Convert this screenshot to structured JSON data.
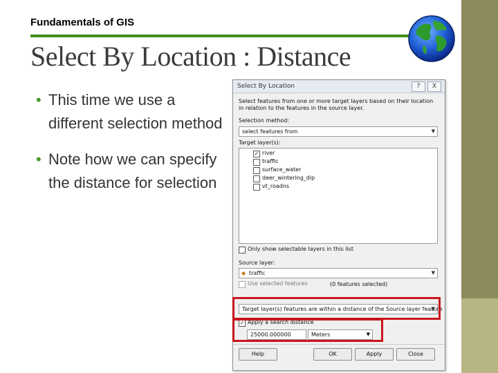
{
  "slide": {
    "course_title": "Fundamentals of GIS",
    "title": "Select By Location : Distance",
    "bullets": [
      "This time we use a different selection method",
      "Note how we can specify the distance for selection"
    ],
    "colors": {
      "accent_green": "#3e8e1a",
      "side_bar": "#8a8a5a",
      "side_bar_accent": "#b7b583",
      "highlight_red": "#c8161d"
    }
  },
  "dialog": {
    "title": "Select By Location",
    "help_button": "?",
    "close_button": "X",
    "description": "Select features from one or more target layers based on their location in relation to the features in the source layer.",
    "selection_method_label": "Selection method:",
    "selection_method_value": "select features from",
    "target_layers_label": "Target layer(s):",
    "target_layers": [
      {
        "label": "river",
        "checked": true
      },
      {
        "label": "traffic",
        "checked": false
      },
      {
        "label": "surface_water",
        "checked": false
      },
      {
        "label": "deer_wintering_dip",
        "checked": false
      },
      {
        "label": "vt_roadns",
        "checked": false
      }
    ],
    "only_selectable_label": "Only show selectable layers in this list",
    "source_layer_label": "Source layer:",
    "source_layer_value": "traffic",
    "use_selected_label": "Use selected features",
    "features_selected": "(0 features selected)",
    "spatial_method_value": "Target layer(s) features are within a distance of the Source layer feature",
    "apply_distance_label": "Apply a search distance",
    "apply_distance_checked": true,
    "distance_value": "25000.000000",
    "distance_unit": "Meters",
    "buttons": {
      "help": "Help",
      "ok": "OK",
      "apply": "Apply",
      "close": "Close"
    }
  }
}
